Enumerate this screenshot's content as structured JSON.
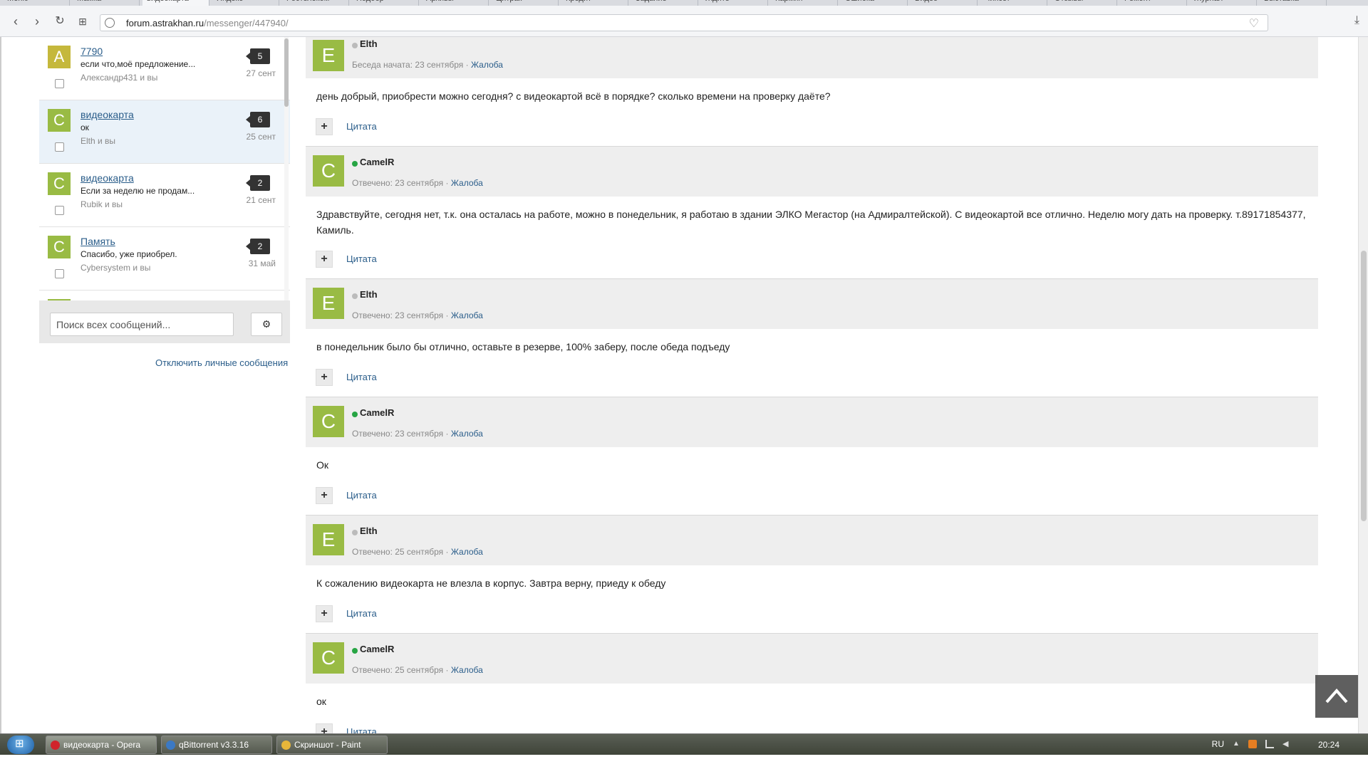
{
  "browser": {
    "tabs": [
      "Меню",
      "Мамка",
      "видеокарта",
      "Яндекс",
      "Ростелеком",
      "Подобр",
      "Архивы",
      "Цитрак",
      "Кредит",
      "Задание",
      "Ждите",
      "Кармин",
      "Ошибка",
      "Видео",
      "Чипсет",
      "Отзывы",
      "Ремонт",
      "Журнал",
      "Выставка"
    ],
    "url_host": "forum.astrakhan.ru",
    "url_path": "/messenger/447940/"
  },
  "sidebar": {
    "conversations": [
      {
        "avatar": "A",
        "title": "7790",
        "preview": "если что,моё предложение...",
        "participants": "Александр431 и вы",
        "count": "5",
        "date": "27 сент",
        "selected": false
      },
      {
        "avatar": "C",
        "title": "видеокарта",
        "preview": "ок",
        "participants": "Elth и вы",
        "count": "6",
        "date": "25 сент",
        "selected": true
      },
      {
        "avatar": "C",
        "title": "видеокарта",
        "preview": "Если за неделю не продам...",
        "participants": "Rubik и вы",
        "count": "2",
        "date": "21 сент",
        "selected": false
      },
      {
        "avatar": "C",
        "title": "Память",
        "preview": "Спасибо, уже приобрел.",
        "participants": "Cybersystem и вы",
        "count": "2",
        "date": "31 май",
        "selected": false
      }
    ],
    "search_placeholder": "Поиск всех сообщений...",
    "disable_pm": "Отключить личные сообщения"
  },
  "messages": [
    {
      "avatar": "E",
      "author": "Elth",
      "online": false,
      "meta": "Беседа начата: 23 сентября",
      "report": "Жалоба",
      "body": "день добрый, приобрести можно сегодня? с видеокартой всё в порядке? сколько времени на проверку даёте?",
      "first": true
    },
    {
      "avatar": "C",
      "author": "CamelR",
      "online": true,
      "meta": "Отвечено: 23 сентября",
      "report": "Жалоба",
      "body": "Здравствуйте, сегодня нет, т.к. она осталась на работе, можно в понедельник, я работаю в здании ЭЛКО Мегастор (на Адмиралтейской). С видеокартой все отлично. Неделю могу дать на проверку. т.89171854377, Камиль.",
      "first": false
    },
    {
      "avatar": "E",
      "author": "Elth",
      "online": false,
      "meta": "Отвечено: 23 сентября",
      "report": "Жалоба",
      "body": "в понедельник было бы отлично, оставьте в резерве, 100% заберу, после обеда подъеду",
      "first": false
    },
    {
      "avatar": "C",
      "author": "CamelR",
      "online": true,
      "meta": "Отвечено: 23 сентября",
      "report": "Жалоба",
      "body": "Ок",
      "first": false
    },
    {
      "avatar": "E",
      "author": "Elth",
      "online": false,
      "meta": "Отвечено: 25 сентября",
      "report": "Жалоба",
      "body": "К сожалению видеокарта не влезла в корпус. Завтра верну, приеду к обеду",
      "first": false
    },
    {
      "avatar": "C",
      "author": "CamelR",
      "online": true,
      "meta": "Отвечено: 25 сентября",
      "report": "Жалоба",
      "body": "ок",
      "first": false
    }
  ],
  "quote_label": "Цитата",
  "taskbar": {
    "items": [
      {
        "label": "видеокарта - Opera",
        "color": "#d0232b"
      },
      {
        "label": "qBittorrent v3.3.16",
        "color": "#3b79c4"
      },
      {
        "label": "Скриншот - Paint",
        "color": "#e8b63a"
      }
    ],
    "lang": "RU",
    "time": "20:24"
  }
}
